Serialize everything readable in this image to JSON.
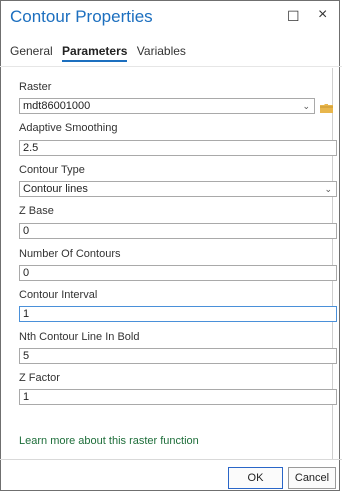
{
  "dialog": {
    "title": "Contour Properties",
    "window_buttons": {
      "maximize": "☐",
      "close": "×"
    }
  },
  "tabs": [
    {
      "label": "General",
      "active": false
    },
    {
      "label": "Parameters",
      "active": true
    },
    {
      "label": "Variables",
      "active": false
    }
  ],
  "params": {
    "raster": {
      "label": "Raster",
      "value": "mdt86001000"
    },
    "adaptive_smoothing": {
      "label": "Adaptive Smoothing",
      "value": "2.5"
    },
    "contour_type": {
      "label": "Contour Type",
      "value": "Contour lines"
    },
    "z_base": {
      "label": "Z Base",
      "value": "0"
    },
    "number_of_contours": {
      "label": "Number Of Contours",
      "value": "0"
    },
    "contour_interval": {
      "label": "Contour Interval",
      "value": "1"
    },
    "nth_bold": {
      "label": "Nth Contour Line In Bold",
      "value": "5"
    },
    "z_factor": {
      "label": "Z Factor",
      "value": "1"
    }
  },
  "learn_more": "Learn more about this raster function",
  "buttons": {
    "ok": "OK",
    "cancel": "Cancel"
  },
  "colors": {
    "accent": "#1c6fbf",
    "link": "#1e6e3a",
    "folder": "#e8b64c"
  }
}
